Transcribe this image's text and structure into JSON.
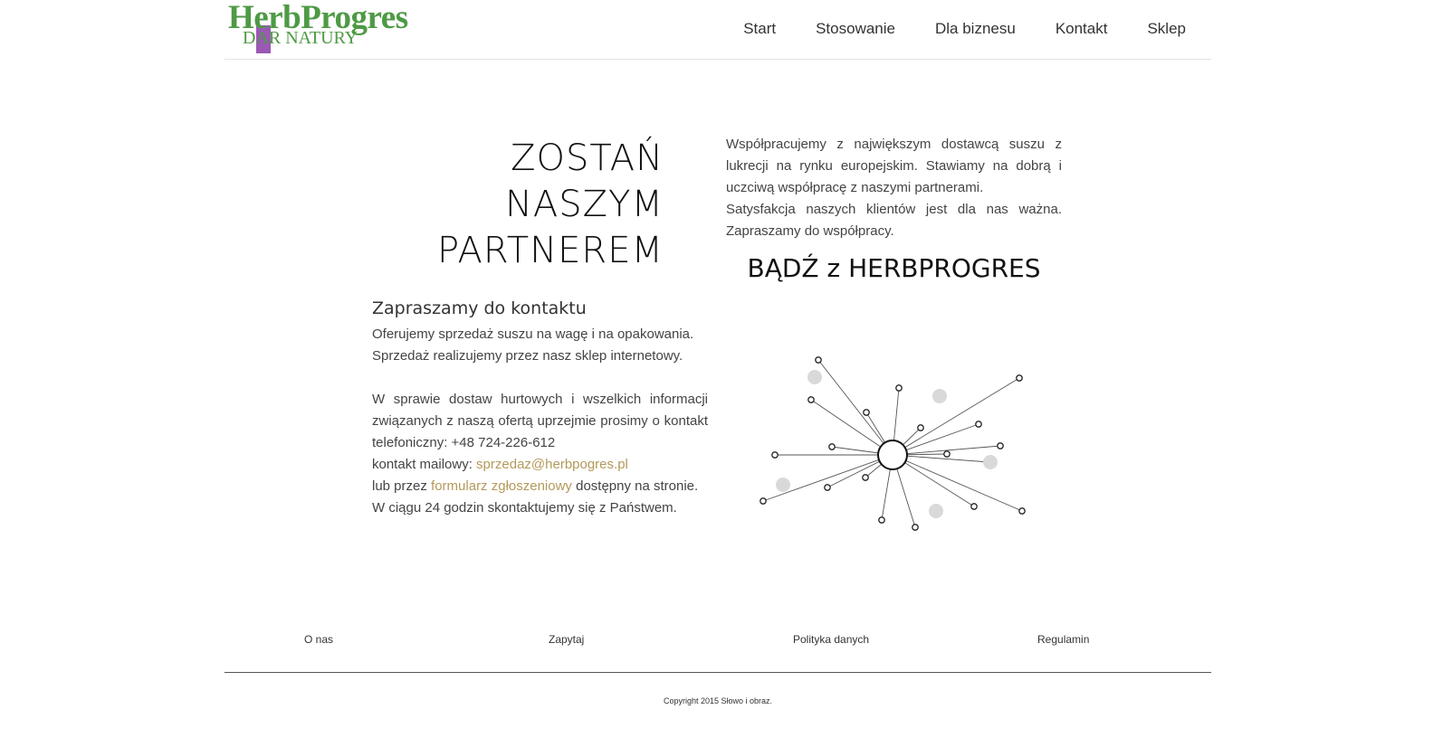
{
  "logo": {
    "main": "HerbProgres",
    "sub": "DAR NATURY"
  },
  "nav": [
    "Start",
    "Stosowanie",
    "Dla biznesu",
    "Kontakt",
    "Sklep"
  ],
  "hero": {
    "lines": [
      "ZOSTAŃ",
      "NASZYM",
      "PARTNEREM"
    ]
  },
  "intro": {
    "p1": "Współpracujemy z największym dostawcą suszu z lukrecji na rynku europejskim. Stawiamy na dobrą i uczciwą współpracę z naszymi partnerami.",
    "p2": "Satysfakcja naszych klientów jest dla nas ważna. Zapraszamy do współpracy."
  },
  "slogan": "BĄDŹ z HERBPROGRES",
  "contact": {
    "heading": "Zapraszamy do kontaktu",
    "line1": "Oferujemy sprzedaż suszu na wagę i na opakowania.",
    "line2": "Sprzedaż realizujemy przez nasz sklep internetowy.",
    "para": "W sprawie dostaw hurtowych i wszelkich informacji związanych z naszą ofertą uprzejmie prosimy o kontakt telefoniczny: +48 724-226-612",
    "mail_prefix": "kontakt mailowy: ",
    "mail": "sprzedaz@herbpogres.pl",
    "form_prefix": "lub przez ",
    "form_link": "formularz zgłoszeniowy",
    "form_suffix": " dostępny na stronie.",
    "last": "W ciągu 24 godzin skontaktujemy się z Państwem."
  },
  "footer": {
    "links": [
      "O nas",
      "Zapytaj",
      "Polityka danych",
      "Regulamin"
    ],
    "copyright": "Copyright 2015 Słowo i obraz."
  }
}
